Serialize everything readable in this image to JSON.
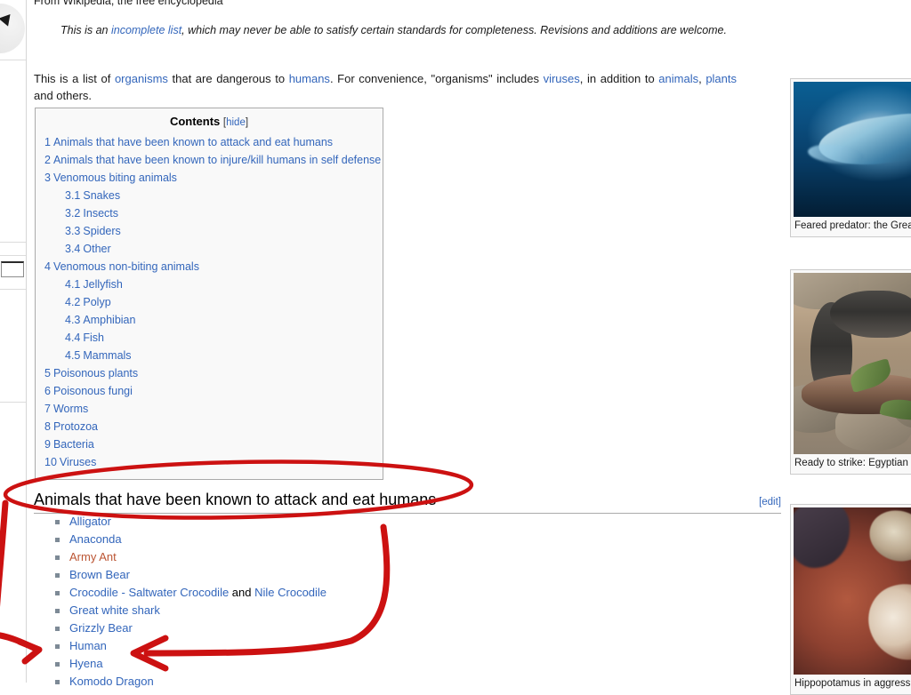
{
  "page": {
    "site_subtitle": "From Wikipedia, the free encyclopedia",
    "notice_prefix": "This is an ",
    "notice_link": "incomplete list",
    "notice_suffix": ", which may never be able to satisfy certain standards for completeness. Revisions and additions are welcome."
  },
  "intro": {
    "t1": "This is a list of ",
    "l1": "organisms",
    "t2": " that are dangerous to ",
    "l2": "humans",
    "t3": ". For convenience, \"organisms\" includes ",
    "l3": "viruses",
    "t4": ", in addition to ",
    "l4": "animals",
    "t5": ", ",
    "l5": "plants",
    "t6": " and others."
  },
  "toc": {
    "title": "Contents",
    "toggle_open": "[",
    "toggle_label": "hide",
    "toggle_close": "]",
    "items": [
      {
        "number": "1",
        "text": "Animals that have been known to attack and eat humans",
        "level": 1
      },
      {
        "number": "2",
        "text": "Animals that have been known to injure/kill humans in self defense",
        "level": 1
      },
      {
        "number": "3",
        "text": "Venomous biting animals",
        "level": 1
      },
      {
        "number": "3.1",
        "text": "Snakes",
        "level": 2
      },
      {
        "number": "3.2",
        "text": "Insects",
        "level": 2
      },
      {
        "number": "3.3",
        "text": "Spiders",
        "level": 2
      },
      {
        "number": "3.4",
        "text": "Other",
        "level": 2
      },
      {
        "number": "4",
        "text": "Venomous non-biting animals",
        "level": 1
      },
      {
        "number": "4.1",
        "text": "Jellyfish",
        "level": 2
      },
      {
        "number": "4.2",
        "text": "Polyp",
        "level": 2
      },
      {
        "number": "4.3",
        "text": "Amphibian",
        "level": 2
      },
      {
        "number": "4.4",
        "text": "Fish",
        "level": 2
      },
      {
        "number": "4.5",
        "text": "Mammals",
        "level": 2
      },
      {
        "number": "5",
        "text": "Poisonous plants",
        "level": 1
      },
      {
        "number": "6",
        "text": "Poisonous fungi",
        "level": 1
      },
      {
        "number": "7",
        "text": "Worms",
        "level": 1
      },
      {
        "number": "8",
        "text": "Protozoa",
        "level": 1
      },
      {
        "number": "9",
        "text": "Bacteria",
        "level": 1
      },
      {
        "number": "10",
        "text": "Viruses",
        "level": 1
      }
    ]
  },
  "section": {
    "heading": "Animals that have been known to attack and eat humans",
    "edit_label": "[edit]"
  },
  "animal_list": [
    {
      "label": "Alligator",
      "style": "link"
    },
    {
      "label": "Anaconda",
      "style": "link"
    },
    {
      "label": "Army Ant",
      "style": "redlink"
    },
    {
      "label": "Brown Bear",
      "style": "link"
    },
    {
      "label": "Crocodile - Saltwater Crocodile and Nile Crocodile",
      "style": "mixed",
      "parts": [
        {
          "text": "Crocodile - Saltwater Crocodile",
          "style": "link"
        },
        {
          "text": " and ",
          "style": "plain"
        },
        {
          "text": "Nile Crocodile",
          "style": "link"
        }
      ]
    },
    {
      "label": "Great white shark",
      "style": "link"
    },
    {
      "label": "Grizzly Bear",
      "style": "link"
    },
    {
      "label": "Human",
      "style": "link"
    },
    {
      "label": "Hyena",
      "style": "link"
    },
    {
      "label": "Komodo Dragon",
      "style": "link"
    }
  ],
  "thumbnails": [
    {
      "name": "great-white-shark",
      "caption": "Feared predator: the Great White s"
    },
    {
      "name": "egyptian-cobra",
      "caption": "Ready to strike: Egyptian Cobra s"
    },
    {
      "name": "hippopotamus",
      "caption": "Hippopotamus in aggressive pos"
    }
  ],
  "annotation": {
    "color": "#cc1111",
    "shapes": [
      {
        "kind": "ellipse",
        "target": "section-heading"
      },
      {
        "kind": "curved-arrow",
        "target": "human-list-item",
        "from": "ellipse-right"
      },
      {
        "kind": "arrow",
        "target": "human-list-item",
        "from": "left-edge"
      }
    ]
  }
}
